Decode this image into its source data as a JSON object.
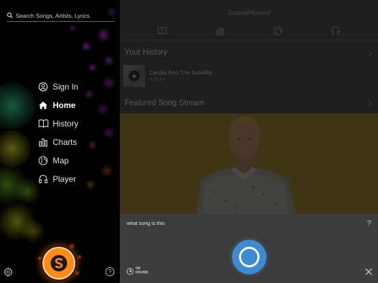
{
  "search": {
    "placeholder": "Search Songs, Artists, Lyrics"
  },
  "sidebar": {
    "items": [
      {
        "label": "Sign In",
        "icon": "user-circle-icon",
        "active": false
      },
      {
        "label": "Home",
        "icon": "home-icon",
        "active": true
      },
      {
        "label": "History",
        "icon": "book-icon",
        "active": false
      },
      {
        "label": "Charts",
        "icon": "bar-chart-icon",
        "active": false
      },
      {
        "label": "Map",
        "icon": "globe-icon",
        "active": false
      },
      {
        "label": "Player",
        "icon": "headphones-icon",
        "active": false
      }
    ],
    "help_label": "?"
  },
  "main": {
    "app_title": "SoundHound",
    "tabs": [
      "book-icon",
      "bar-chart-icon",
      "globe-icon",
      "headphones-icon"
    ],
    "history_title": "Your History",
    "history_item": {
      "song": "Cecilia And The Satellite",
      "time": "8:15 am"
    },
    "featured_title": "Featured Song Stream"
  },
  "listening": {
    "query": "what song is this",
    "help_label": "?",
    "ok_hound": "OK HOUND",
    "ok_hound_line1": "OK",
    "ok_hound_line2": "HOUND"
  },
  "colors": {
    "accent_orange": "#ff8c1a",
    "listen_blue": "#3f8ad0",
    "featured_yellow": "#3a3115"
  }
}
